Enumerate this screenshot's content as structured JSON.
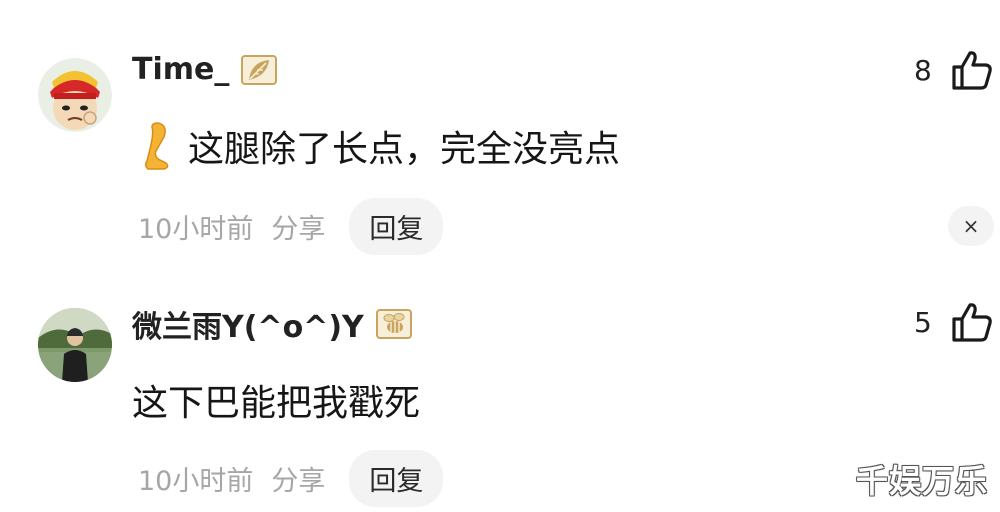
{
  "comments": [
    {
      "username": "Time_",
      "avatar": "cartoon-avatar-red-hat",
      "badge_icon": "leaf-badge-icon",
      "content_emoji": "leg-emoji",
      "content": "这腿除了长点，完全没亮点",
      "time": "10小时前",
      "share_label": "分享",
      "reply_label": "回复",
      "like_count": "8",
      "close_label": "×"
    },
    {
      "username": "微兰雨Y(^o^)Y",
      "avatar": "photo-avatar-person-outdoors",
      "badge_icon": "bee-badge-icon",
      "content": "这下巴能把我戳死",
      "time": "10小时前",
      "share_label": "分享",
      "reply_label": "回复",
      "like_count": "5"
    }
  ],
  "watermark": "千娱万乐",
  "colors": {
    "meta_text": "#a6a6a6",
    "reply_bg": "#f3f3f3",
    "badge_gold": "#c9a45c"
  }
}
